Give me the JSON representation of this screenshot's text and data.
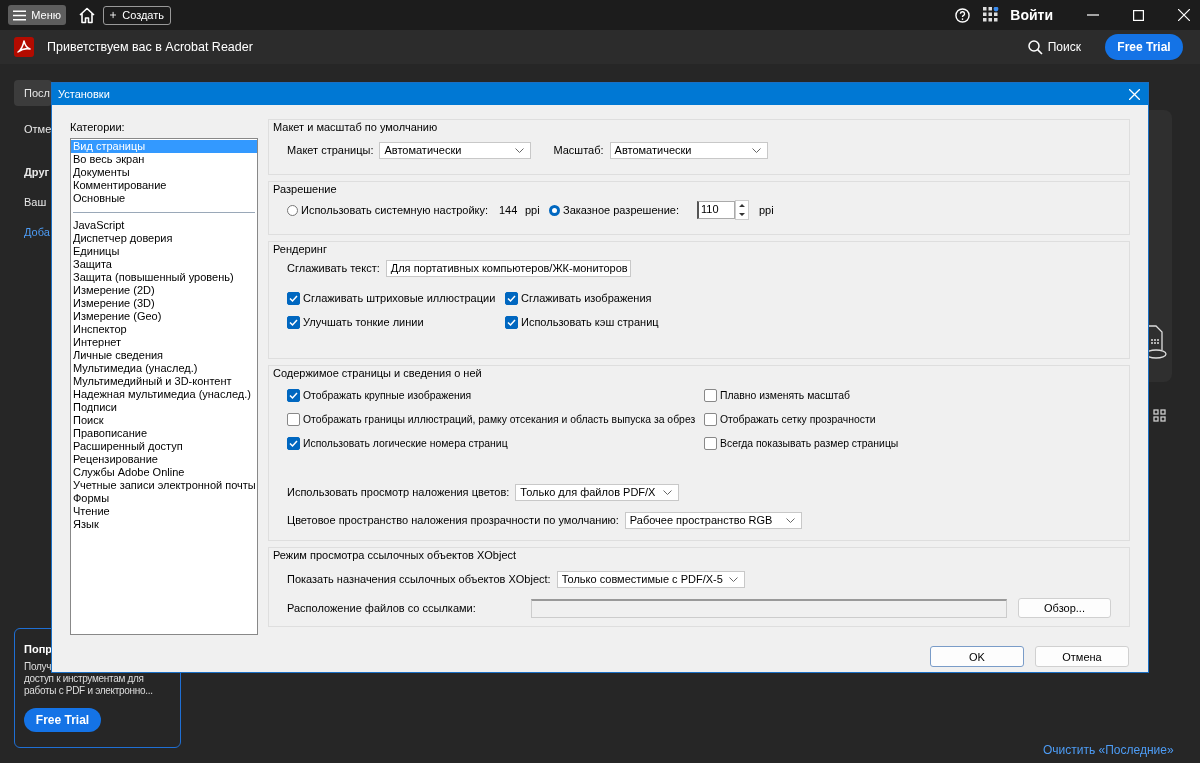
{
  "app": {
    "menu_button": "Меню",
    "create_button": "Создать",
    "sign_in": "Войти",
    "title": "Приветствуем вас в Acrobat Reader",
    "search": "Поиск",
    "trial_button": "Free Trial"
  },
  "sidebar": [
    {
      "label": "Посл",
      "kind": "tab"
    },
    {
      "label": "Отме",
      "kind": "item"
    },
    {
      "label": "Друг",
      "kind": "heading"
    },
    {
      "label": "Ваш",
      "kind": "item"
    },
    {
      "label": "Доба",
      "kind": "link"
    }
  ],
  "promo": {
    "title": "Попр",
    "lines": [
      "Получ",
      "доступ к инструментам для",
      "работы с PDF и электронно..."
    ],
    "button": "Free Trial"
  },
  "clear_recent": "Очистить «Последние»",
  "dialog": {
    "title": "Установки",
    "categories_label": "Категории:",
    "category_groups": [
      [
        {
          "label": "Вид страницы",
          "selected": true
        },
        {
          "label": "Во весь экран",
          "selected": false
        },
        {
          "label": "Документы",
          "selected": false
        },
        {
          "label": "Комментирование",
          "selected": false
        },
        {
          "label": "Основные",
          "selected": false
        }
      ],
      [
        {
          "label": "JavaScript",
          "selected": false
        },
        {
          "label": "Диспетчер доверия",
          "selected": false
        },
        {
          "label": "Единицы",
          "selected": false
        },
        {
          "label": "Защита",
          "selected": false
        },
        {
          "label": "Защита (повышенный уровень)",
          "selected": false
        },
        {
          "label": "Измерение (2D)",
          "selected": false
        },
        {
          "label": "Измерение (3D)",
          "selected": false
        },
        {
          "label": "Измерение (Geo)",
          "selected": false
        },
        {
          "label": "Инспектор",
          "selected": false
        },
        {
          "label": "Интернет",
          "selected": false
        },
        {
          "label": "Личные сведения",
          "selected": false
        },
        {
          "label": "Мультимедиа (унаслед.)",
          "selected": false
        },
        {
          "label": "Мультимедийный и 3D-контент",
          "selected": false
        },
        {
          "label": "Надежная мультимедиа (унаслед.)",
          "selected": false
        },
        {
          "label": "Подписи",
          "selected": false
        },
        {
          "label": "Поиск",
          "selected": false
        },
        {
          "label": "Правописание",
          "selected": false
        },
        {
          "label": "Расширенный доступ",
          "selected": false
        },
        {
          "label": "Рецензирование",
          "selected": false
        },
        {
          "label": "Службы Adobe Online",
          "selected": false
        },
        {
          "label": "Учетные записи электронной почты",
          "selected": false
        },
        {
          "label": "Формы",
          "selected": false
        },
        {
          "label": "Чтение",
          "selected": false
        },
        {
          "label": "Язык",
          "selected": false
        }
      ]
    ],
    "layout": {
      "title": "Макет и масштаб по умолчанию",
      "page_layout_label": "Макет страницы:",
      "page_layout": "Автоматически",
      "zoom_label": "Масштаб:",
      "zoom": "Автоматически"
    },
    "resolution": {
      "title": "Разрешение",
      "options": [
        {
          "label": "Использовать системную настройку:",
          "selected": false
        },
        {
          "label": "Заказное разрешение:",
          "selected": true
        }
      ],
      "system_value": "144",
      "system_unit": "ppi",
      "custom_value": "110",
      "custom_unit": "ppi"
    },
    "rendering": {
      "title": "Рендеринг",
      "smooth_text_label": "Сглаживать текст:",
      "smooth_text": "Для портативных компьютеров/ЖК-мониторов",
      "checkboxes": [
        {
          "label": "Сглаживать штриховые иллюстрации",
          "checked": true
        },
        {
          "label": "Сглаживать изображения",
          "checked": true
        },
        {
          "label": "Улучшать тонкие линии",
          "checked": true
        },
        {
          "label": "Использовать кэш страниц",
          "checked": true
        }
      ]
    },
    "page_content": {
      "title": "Содержимое страницы и сведения о ней",
      "checkboxes": [
        {
          "label": "Отображать крупные изображения",
          "checked": true
        },
        {
          "label": "Плавно изменять масштаб",
          "checked": false
        },
        {
          "label": "Отображать границы иллюстраций, рамку отсекания и область выпуска за обрез",
          "checked": false
        },
        {
          "label": "Отображать сетку прозрачности",
          "checked": false
        },
        {
          "label": "Использовать логические номера страниц",
          "checked": true
        },
        {
          "label": "Всегда показывать размер страницы",
          "checked": false
        }
      ],
      "overprint_label": "Использовать просмотр наложения цветов:",
      "overprint": "Только для файлов PDF/X",
      "blend_label": "Цветовое пространство наложения прозрачности по умолчанию:",
      "blend": "Рабочее пространство RGB"
    },
    "xobject": {
      "title": "Режим просмотра ссылочных объектов XObject",
      "show_label": "Показать назначения ссылочных объектов XObject:",
      "show": "Только совместимые с PDF/X-5",
      "location_label": "Расположение файлов со ссылками:",
      "browse_button": "Обзор..."
    },
    "buttons": [
      "OK",
      "Отмена"
    ]
  }
}
